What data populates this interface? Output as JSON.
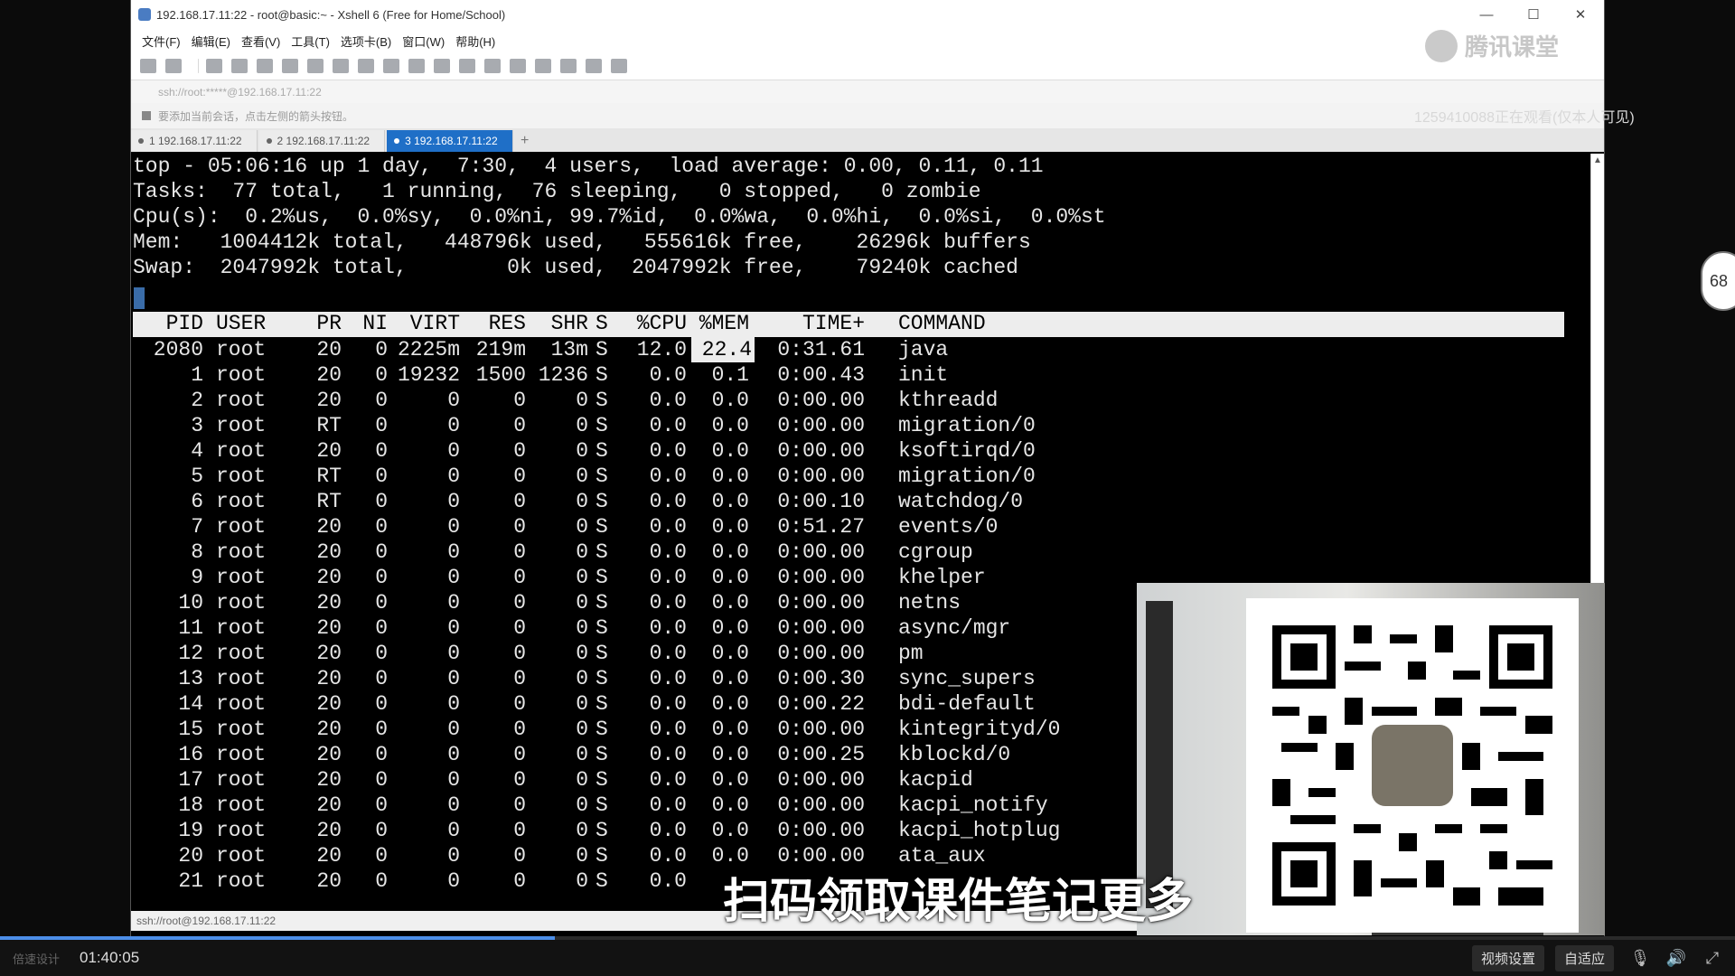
{
  "window": {
    "title": "192.168.17.11:22 - root@basic:~ - Xshell 6 (Free for Home/School)",
    "controls": [
      "—",
      "☐",
      "✕"
    ]
  },
  "menu": [
    "文件(F)",
    "编辑(E)",
    "查看(V)",
    "工具(T)",
    "选项卡(B)",
    "窗口(W)",
    "帮助(H)"
  ],
  "address": "ssh://root:*****@192.168.17.11:22",
  "hint": "要添加当前会话，点击左侧的箭头按钮。",
  "tabs": [
    {
      "label": "1 192.168.17.11:22"
    },
    {
      "label": "2 192.168.17.11:22"
    },
    {
      "label": "3 192.168.17.11:22"
    }
  ],
  "watermark": "腾讯课堂",
  "viewer_note": "1259410088正在观看(仅本人可见)",
  "top_summary": [
    "top - 05:06:16 up 1 day,  7:30,  4 users,  load average: 0.00, 0.11, 0.11",
    "Tasks:  77 total,   1 running,  76 sleeping,   0 stopped,   0 zombie",
    "Cpu(s):  0.2%us,  0.0%sy,  0.0%ni, 99.7%id,  0.0%wa,  0.0%hi,  0.0%si,  0.0%st",
    "Mem:   1004412k total,   448796k used,   555616k free,    26296k buffers",
    "Swap:  2047992k total,        0k used,  2047992k free,    79240k cached"
  ],
  "columns": [
    "PID",
    "USER",
    "PR",
    "NI",
    "VIRT",
    "RES",
    "SHR",
    "S",
    "%CPU",
    "%MEM",
    "TIME+",
    "COMMAND"
  ],
  "processes": [
    [
      "2080",
      "root",
      "20",
      "0",
      "2225m",
      "219m",
      "13m",
      "S",
      "12.0",
      "22.4",
      "0:31.61",
      "java"
    ],
    [
      "1",
      "root",
      "20",
      "0",
      "19232",
      "1500",
      "1236",
      "S",
      "0.0",
      "0.1",
      "0:00.43",
      "init"
    ],
    [
      "2",
      "root",
      "20",
      "0",
      "0",
      "0",
      "0",
      "S",
      "0.0",
      "0.0",
      "0:00.00",
      "kthreadd"
    ],
    [
      "3",
      "root",
      "RT",
      "0",
      "0",
      "0",
      "0",
      "S",
      "0.0",
      "0.0",
      "0:00.00",
      "migration/0"
    ],
    [
      "4",
      "root",
      "20",
      "0",
      "0",
      "0",
      "0",
      "S",
      "0.0",
      "0.0",
      "0:00.00",
      "ksoftirqd/0"
    ],
    [
      "5",
      "root",
      "RT",
      "0",
      "0",
      "0",
      "0",
      "S",
      "0.0",
      "0.0",
      "0:00.00",
      "migration/0"
    ],
    [
      "6",
      "root",
      "RT",
      "0",
      "0",
      "0",
      "0",
      "S",
      "0.0",
      "0.0",
      "0:00.10",
      "watchdog/0"
    ],
    [
      "7",
      "root",
      "20",
      "0",
      "0",
      "0",
      "0",
      "S",
      "0.0",
      "0.0",
      "0:51.27",
      "events/0"
    ],
    [
      "8",
      "root",
      "20",
      "0",
      "0",
      "0",
      "0",
      "S",
      "0.0",
      "0.0",
      "0:00.00",
      "cgroup"
    ],
    [
      "9",
      "root",
      "20",
      "0",
      "0",
      "0",
      "0",
      "S",
      "0.0",
      "0.0",
      "0:00.00",
      "khelper"
    ],
    [
      "10",
      "root",
      "20",
      "0",
      "0",
      "0",
      "0",
      "S",
      "0.0",
      "0.0",
      "0:00.00",
      "netns"
    ],
    [
      "11",
      "root",
      "20",
      "0",
      "0",
      "0",
      "0",
      "S",
      "0.0",
      "0.0",
      "0:00.00",
      "async/mgr"
    ],
    [
      "12",
      "root",
      "20",
      "0",
      "0",
      "0",
      "0",
      "S",
      "0.0",
      "0.0",
      "0:00.00",
      "pm"
    ],
    [
      "13",
      "root",
      "20",
      "0",
      "0",
      "0",
      "0",
      "S",
      "0.0",
      "0.0",
      "0:00.30",
      "sync_supers"
    ],
    [
      "14",
      "root",
      "20",
      "0",
      "0",
      "0",
      "0",
      "S",
      "0.0",
      "0.0",
      "0:00.22",
      "bdi-default"
    ],
    [
      "15",
      "root",
      "20",
      "0",
      "0",
      "0",
      "0",
      "S",
      "0.0",
      "0.0",
      "0:00.00",
      "kintegrityd/0"
    ],
    [
      "16",
      "root",
      "20",
      "0",
      "0",
      "0",
      "0",
      "S",
      "0.0",
      "0.0",
      "0:00.25",
      "kblockd/0"
    ],
    [
      "17",
      "root",
      "20",
      "0",
      "0",
      "0",
      "0",
      "S",
      "0.0",
      "0.0",
      "0:00.00",
      "kacpid"
    ],
    [
      "18",
      "root",
      "20",
      "0",
      "0",
      "0",
      "0",
      "S",
      "0.0",
      "0.0",
      "0:00.00",
      "kacpi_notify"
    ],
    [
      "19",
      "root",
      "20",
      "0",
      "0",
      "0",
      "0",
      "S",
      "0.0",
      "0.0",
      "0:00.00",
      "kacpi_hotplug"
    ],
    [
      "20",
      "root",
      "20",
      "0",
      "0",
      "0",
      "0",
      "S",
      "0.0",
      "0.0",
      "0:00.00",
      "ata_aux"
    ],
    [
      "21",
      "root",
      "20",
      "0",
      "0",
      "0",
      "0",
      "S",
      "0.0",
      "",
      ""
    ]
  ],
  "statusbar": "ssh://root@192.168.17.11:22",
  "subtitle": "扫码领取课件笔记更多",
  "player": {
    "speed_label": "倍速设计",
    "time": "01:40:05",
    "progress": 0.32,
    "buttons": [
      "视频设置",
      "自适应"
    ],
    "icons": [
      "mic-icon",
      "volume-icon",
      "fullscreen-icon"
    ]
  },
  "side_badge": "68",
  "colors": {
    "accent": "#1f6fc7",
    "terminal_bg": "#000000",
    "terminal_fg": "#e6e6e6"
  }
}
